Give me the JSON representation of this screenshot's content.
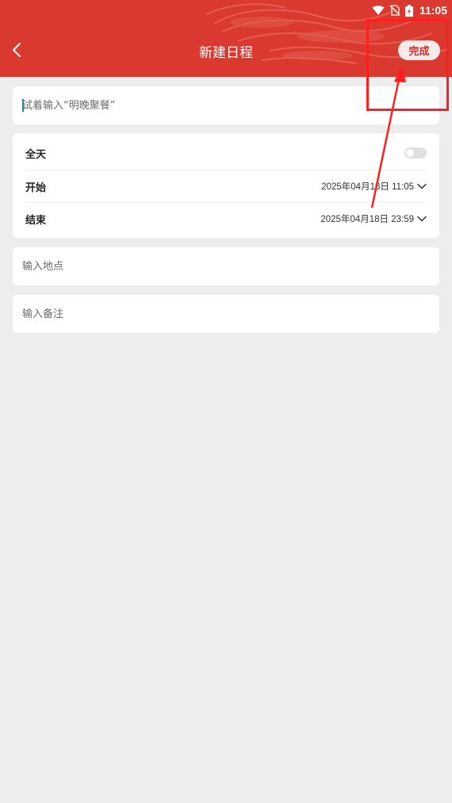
{
  "status_bar": {
    "time": "11:05",
    "icons": [
      "wifi-icon",
      "no-sim-icon",
      "battery-charging-icon"
    ]
  },
  "header": {
    "title": "新建日程",
    "back_icon": "chevron-left-icon",
    "done_label": "完成"
  },
  "form": {
    "title_placeholder": "试着输入“明晚聚餐”",
    "allday_label": "全天",
    "allday_on": false,
    "start_label": "开始",
    "start_value": "2025年04月18日 11:05",
    "end_label": "结束",
    "end_value": "2025年04月18日 23:59",
    "location_placeholder": "输入地点",
    "note_placeholder": "输入备注"
  },
  "colors": {
    "header": "#d9392e",
    "page_background": "#ededed",
    "annotation": "#ff1f1f"
  }
}
